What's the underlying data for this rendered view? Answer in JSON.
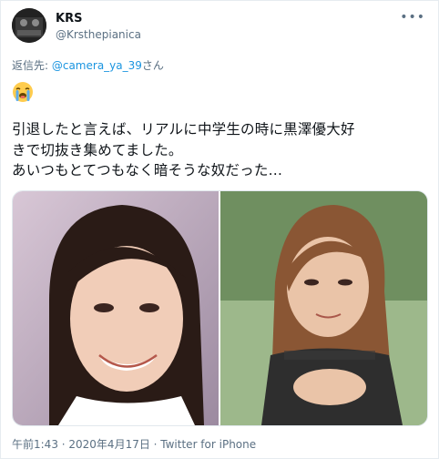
{
  "tweet": {
    "display_name": "KRS",
    "handle": "@Krsthepianica",
    "more_icon": "ellipsis-icon",
    "reply_prefix": "返信先: ",
    "reply_mention": "@camera_ya_39",
    "reply_suffix": "さん",
    "emoji": "loudly-crying-face",
    "text": "引退したと言えば、リアルに中学生の時に黒澤優大好\nきで切抜き集めてました。\nあいつもとてつもなく暗そうな奴だった…",
    "timestamp": "午前1:43 · 2020年4月17日 · Twitter for iPhone"
  },
  "colors": {
    "accent": "#1b95e0",
    "secondary_text": "#5b7083",
    "border": "#e6ecf0"
  }
}
